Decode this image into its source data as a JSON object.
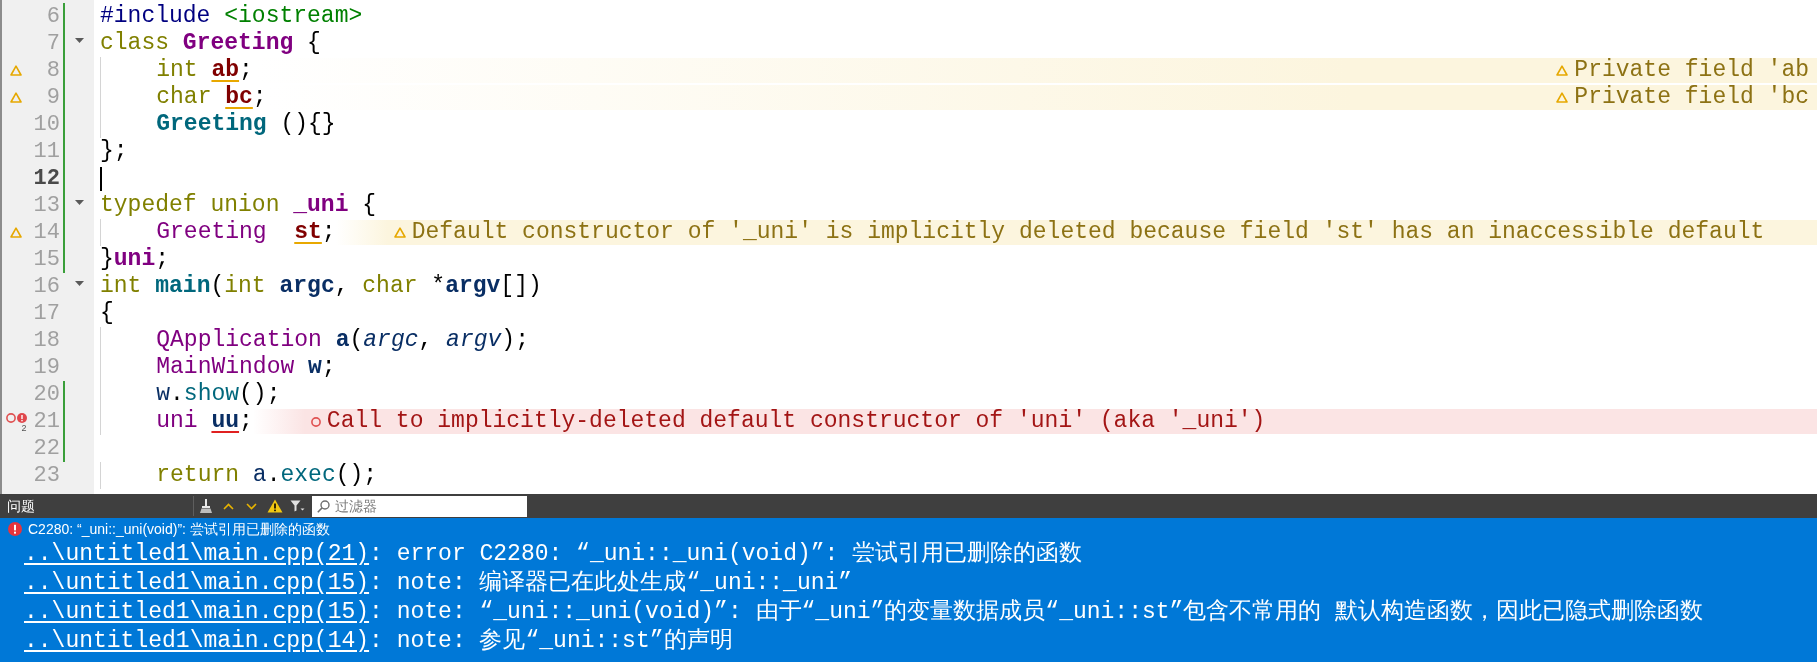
{
  "editor": {
    "lines": [
      {
        "number": "6",
        "foldable": false,
        "changed": true,
        "current": false,
        "tokens": [
          {
            "text": "#include ",
            "kind": "preproc",
            "underlined": false
          },
          {
            "text": "<iostream>",
            "kind": "string",
            "underlined": false
          }
        ]
      },
      {
        "number": "7",
        "foldable": true,
        "changed": true,
        "current": false,
        "tokens": [
          {
            "text": "class ",
            "kind": "keyword",
            "underlined": false
          },
          {
            "text": "Greeting",
            "kind": "type_decl",
            "underlined": false
          },
          {
            "text": " {",
            "kind": "plain",
            "underlined": false
          }
        ]
      },
      {
        "number": "8",
        "foldable": false,
        "changed": true,
        "current": false,
        "tokens": [
          {
            "text": "    int ",
            "kind": "keyword",
            "underlined": false
          },
          {
            "text": "ab",
            "kind": "field_decl",
            "underlined": true
          },
          {
            "text": ";",
            "kind": "plain",
            "underlined": false
          }
        ],
        "diagnostic": {
          "kind": "warning",
          "right_aligned": true,
          "text": "Private field 'ab"
        }
      },
      {
        "number": "9",
        "foldable": false,
        "changed": true,
        "current": false,
        "tokens": [
          {
            "text": "    char ",
            "kind": "keyword",
            "underlined": false
          },
          {
            "text": "bc",
            "kind": "field_decl",
            "underlined": true
          },
          {
            "text": ";",
            "kind": "plain",
            "underlined": false
          }
        ],
        "diagnostic": {
          "kind": "warning",
          "right_aligned": true,
          "text": "Private field 'bc"
        }
      },
      {
        "number": "10",
        "foldable": false,
        "changed": true,
        "current": false,
        "tokens": [
          {
            "text": "    Greeting",
            "kind": "function_decl",
            "underlined": false
          },
          {
            "text": " (){}",
            "kind": "plain",
            "underlined": false
          }
        ]
      },
      {
        "number": "11",
        "foldable": false,
        "changed": true,
        "current": false,
        "tokens": [
          {
            "text": "};",
            "kind": "plain",
            "underlined": false
          }
        ]
      },
      {
        "number": "12",
        "foldable": false,
        "changed": true,
        "current": true
      },
      {
        "number": "13",
        "foldable": true,
        "changed": true,
        "current": false,
        "tokens": [
          {
            "text": "typedef union ",
            "kind": "keyword",
            "underlined": false
          },
          {
            "text": "_uni",
            "kind": "type_decl",
            "underlined": false
          },
          {
            "text": " {",
            "kind": "plain",
            "underlined": false
          }
        ]
      },
      {
        "number": "14",
        "foldable": false,
        "changed": true,
        "current": false,
        "tokens": [
          {
            "text": "    Greeting  ",
            "kind": "type",
            "underlined": false
          },
          {
            "text": "st",
            "kind": "field_decl",
            "underlined": true
          },
          {
            "text": ";",
            "kind": "plain",
            "underlined": false
          }
        ],
        "diagnostic": {
          "kind": "warning",
          "right_aligned": false,
          "text": "Default constructor of '_uni' is implicitly deleted because field 'st' has an inaccessible default"
        }
      },
      {
        "number": "15",
        "foldable": false,
        "changed": true,
        "current": false,
        "tokens": [
          {
            "text": "}",
            "kind": "plain",
            "underlined": false
          },
          {
            "text": "uni",
            "kind": "type_decl",
            "underlined": false
          },
          {
            "text": ";",
            "kind": "plain",
            "underlined": false
          }
        ]
      },
      {
        "number": "16",
        "foldable": true,
        "changed": false,
        "current": false,
        "tokens": [
          {
            "text": "int ",
            "kind": "keyword",
            "underlined": false
          },
          {
            "text": "main",
            "kind": "function_decl",
            "underlined": false
          },
          {
            "text": "(",
            "kind": "plain",
            "underlined": false
          },
          {
            "text": "int ",
            "kind": "keyword",
            "underlined": false
          },
          {
            "text": "argc",
            "kind": "param_decl",
            "underlined": false
          },
          {
            "text": ", ",
            "kind": "plain",
            "underlined": false
          },
          {
            "text": "char ",
            "kind": "keyword",
            "underlined": false
          },
          {
            "text": "*",
            "kind": "plain",
            "underlined": false
          },
          {
            "text": "argv",
            "kind": "param_decl",
            "underlined": false
          },
          {
            "text": "[])",
            "kind": "plain",
            "underlined": false
          }
        ]
      },
      {
        "number": "17",
        "foldable": false,
        "changed": false,
        "current": false,
        "tokens": [
          {
            "text": "{",
            "kind": "plain",
            "underlined": false
          }
        ]
      },
      {
        "number": "18",
        "foldable": false,
        "changed": false,
        "current": false,
        "tokens": [
          {
            "text": "    QApplication ",
            "kind": "type",
            "underlined": false
          },
          {
            "text": "a",
            "kind": "local_decl",
            "underlined": false
          },
          {
            "text": "(",
            "kind": "plain",
            "underlined": false
          },
          {
            "text": "argc",
            "kind": "param",
            "underlined": false
          },
          {
            "text": ", ",
            "kind": "plain",
            "underlined": false
          },
          {
            "text": "argv",
            "kind": "param",
            "underlined": false
          },
          {
            "text": ");",
            "kind": "plain",
            "underlined": false
          }
        ]
      },
      {
        "number": "19",
        "foldable": false,
        "changed": false,
        "current": false,
        "tokens": [
          {
            "text": "    MainWindow ",
            "kind": "type",
            "underlined": false
          },
          {
            "text": "w",
            "kind": "local_decl",
            "underlined": false
          },
          {
            "text": ";",
            "kind": "plain",
            "underlined": false
          }
        ]
      },
      {
        "number": "20",
        "foldable": false,
        "changed": true,
        "current": false,
        "tokens": [
          {
            "text": "    w",
            "kind": "local",
            "underlined": false
          },
          {
            "text": ".",
            "kind": "plain",
            "underlined": false
          },
          {
            "text": "show",
            "kind": "function",
            "underlined": false
          },
          {
            "text": "();",
            "kind": "plain",
            "underlined": false
          }
        ]
      },
      {
        "number": "21",
        "foldable": false,
        "changed": true,
        "current": false,
        "tokens": [
          {
            "text": "    uni ",
            "kind": "type",
            "underlined": false
          },
          {
            "text": "uu",
            "kind": "local_decl",
            "underlined": true
          },
          {
            "text": ";",
            "kind": "plain",
            "underlined": false
          }
        ],
        "diagnostic": {
          "kind": "error",
          "right_aligned": false,
          "count": "2",
          "text": "Call to implicitly-deleted default constructor of 'uni' (aka '_uni')"
        }
      },
      {
        "number": "22",
        "foldable": false,
        "changed": true,
        "current": false
      },
      {
        "number": "23",
        "foldable": false,
        "changed": false,
        "current": false,
        "tokens": [
          {
            "text": "    return ",
            "kind": "keyword",
            "underlined": false
          },
          {
            "text": "a",
            "kind": "local",
            "underlined": false
          },
          {
            "text": ".",
            "kind": "plain",
            "underlined": false
          },
          {
            "text": "exec",
            "kind": "function",
            "underlined": false
          },
          {
            "text": "();",
            "kind": "plain",
            "underlined": false
          }
        ]
      }
    ]
  },
  "issues_panel": {
    "title": "问题",
    "filter": {
      "placeholder": "过滤器"
    },
    "issues": [
      {
        "kind": "error",
        "selected": true,
        "text": "C2280: “_uni::_uni(void)”: 尝试引用已删除的函数",
        "details": [
          {
            "location": "..\\untitled1\\main.cpp(21)",
            "message": ": error C2280: “_uni::_uni(void)”: 尝试引用已删除的函数"
          },
          {
            "location": "..\\untitled1\\main.cpp(15)",
            "message": ": note: 编译器已在此处生成“_uni::_uni”"
          },
          {
            "location": "..\\untitled1\\main.cpp(15)",
            "message": ": note: “_uni::_uni(void)”: 由于“_uni”的变量数据成员“_uni::st”包含不常用的 默认构造函数，因此已隐式删除函数"
          },
          {
            "location": "..\\untitled1\\main.cpp(14)",
            "message": ": note: 参见“_uni::st”的声明"
          }
        ]
      }
    ]
  }
}
